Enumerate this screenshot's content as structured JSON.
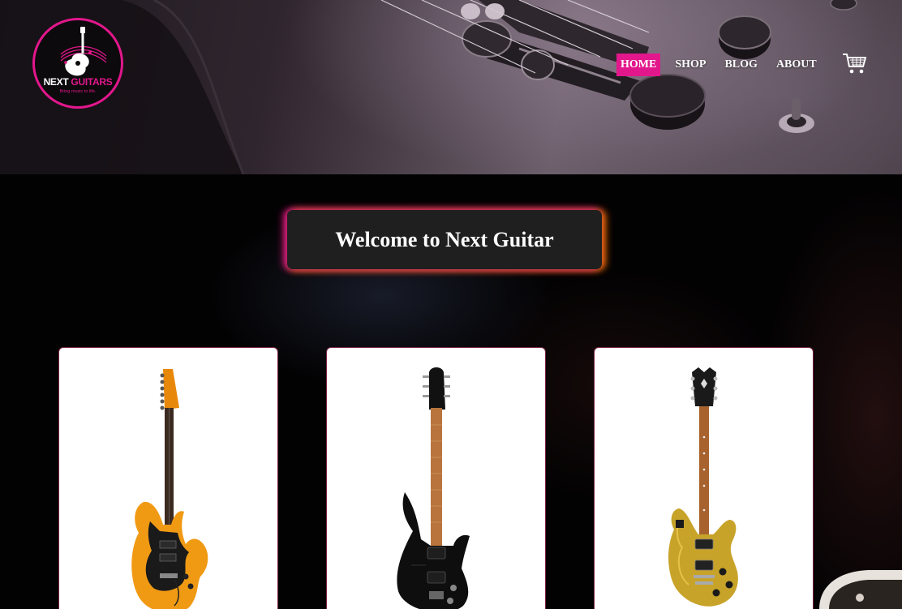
{
  "logo": {
    "title_main": "NEXT",
    "title_accent": "GUITARS",
    "tagline": "Bring music to life."
  },
  "nav": {
    "items": [
      {
        "label": "HOME",
        "active": true
      },
      {
        "label": "SHOP",
        "active": false
      },
      {
        "label": "BLOG",
        "active": false
      },
      {
        "label": "ABOUT",
        "active": false
      }
    ],
    "cart_icon": "shopping-cart-icon"
  },
  "main": {
    "welcome_title": "Welcome to Next Guitar"
  },
  "products": [
    {
      "image": "orange-electric-guitar",
      "body_color": "#f09a14",
      "pickguard_color": "#1a1a1a",
      "neck_color": "#3b2a20"
    },
    {
      "image": "black-electric-guitar",
      "body_color": "#0e0e0e",
      "pickguard_color": "#222222",
      "neck_color": "#b8743c"
    },
    {
      "image": "gold-electric-guitar",
      "body_color": "#c8a32a",
      "pickguard_color": "#1a1a1a",
      "neck_color": "#a8622e"
    }
  ],
  "colors": {
    "accent": "#e2178c",
    "glow_secondary": "#ff7800"
  }
}
